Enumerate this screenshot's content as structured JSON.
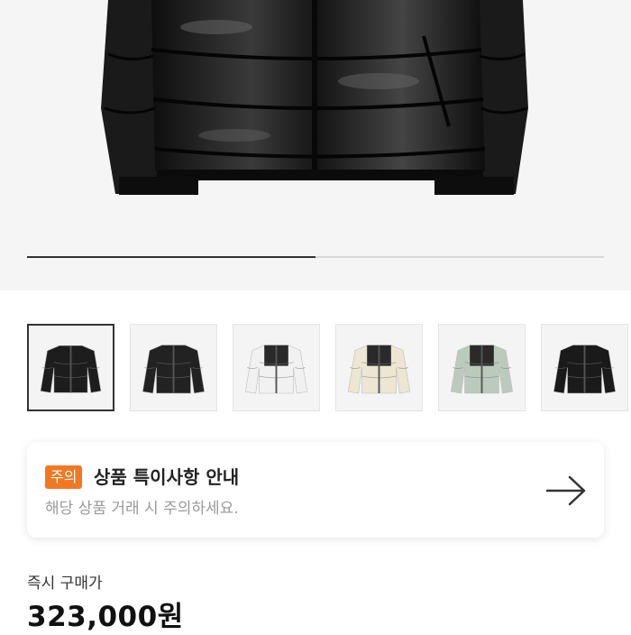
{
  "gallery": {
    "main_image_icon": "black-puffer-jacket",
    "slide_progress": 0.5,
    "thumbnails": [
      {
        "icon": "black-glossy-puffer-jacket",
        "color": "#1d1d1d",
        "accent": "#1d1d1d",
        "selected": true
      },
      {
        "icon": "black-matte-puffer-jacket",
        "color": "#222222",
        "accent": "#222222",
        "selected": false
      },
      {
        "icon": "white-puffer-jacket",
        "color": "#f1f1f1",
        "accent": "#2a2a2a",
        "selected": false
      },
      {
        "icon": "cream-puffer-jacket",
        "color": "#ece6d2",
        "accent": "#2a2a2a",
        "selected": false
      },
      {
        "icon": "sage-puffer-jacket",
        "color": "#bccabd",
        "accent": "#2a2a2a",
        "selected": false
      },
      {
        "icon": "black-puffer-jacket",
        "color": "#1a1a1a",
        "accent": "#1a1a1a",
        "selected": false
      }
    ]
  },
  "notice": {
    "badge": "주의",
    "title": "상품 특이사항 안내",
    "description": "해당 상품 거래 시 주의하세요.",
    "arrow_icon": "arrow-right-icon",
    "badge_color": "#f2781f"
  },
  "price": {
    "label": "즉시 구매가",
    "value": "323,000원"
  }
}
